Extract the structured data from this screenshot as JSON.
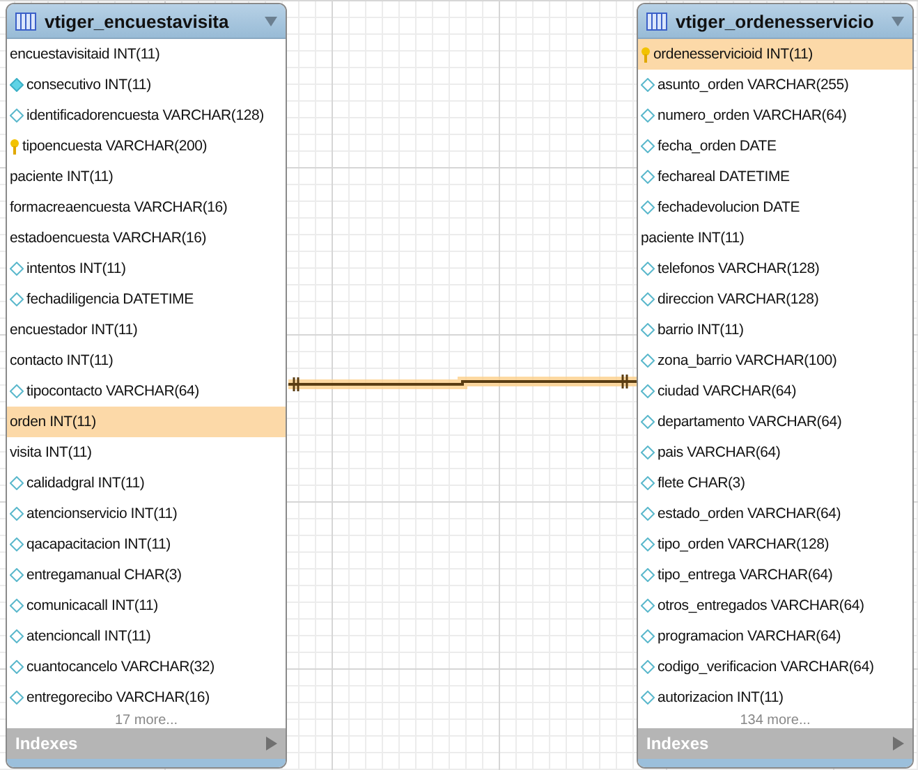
{
  "tables": [
    {
      "title": "vtiger_encuestavisita",
      "more": "17 more...",
      "section": "Indexes",
      "columns": [
        {
          "text": "encuestavisitaid INT(11)",
          "kind": "plain",
          "selected": false
        },
        {
          "text": "consecutivo INT(11)",
          "kind": "unique",
          "selected": false
        },
        {
          "text": "identificadorencuesta VARCHAR(128)",
          "kind": "nullable",
          "selected": false
        },
        {
          "text": "tipoencuesta VARCHAR(200)",
          "kind": "key",
          "selected": false
        },
        {
          "text": "paciente INT(11)",
          "kind": "plain",
          "selected": false
        },
        {
          "text": "formacreaencuesta VARCHAR(16)",
          "kind": "plain",
          "selected": false
        },
        {
          "text": "estadoencuesta VARCHAR(16)",
          "kind": "plain",
          "selected": false
        },
        {
          "text": "intentos INT(11)",
          "kind": "nullable",
          "selected": false
        },
        {
          "text": "fechadiligencia DATETIME",
          "kind": "nullable",
          "selected": false
        },
        {
          "text": "encuestador INT(11)",
          "kind": "plain",
          "selected": false
        },
        {
          "text": "contacto INT(11)",
          "kind": "plain",
          "selected": false
        },
        {
          "text": "tipocontacto VARCHAR(64)",
          "kind": "nullable",
          "selected": false
        },
        {
          "text": "orden INT(11)",
          "kind": "plain",
          "selected": true
        },
        {
          "text": "visita INT(11)",
          "kind": "plain",
          "selected": false
        },
        {
          "text": "calidadgral INT(11)",
          "kind": "nullable",
          "selected": false
        },
        {
          "text": "atencionservicio INT(11)",
          "kind": "nullable",
          "selected": false
        },
        {
          "text": "qacapacitacion INT(11)",
          "kind": "nullable",
          "selected": false
        },
        {
          "text": "entregamanual CHAR(3)",
          "kind": "nullable",
          "selected": false
        },
        {
          "text": "comunicacall INT(11)",
          "kind": "nullable",
          "selected": false
        },
        {
          "text": "atencioncall INT(11)",
          "kind": "nullable",
          "selected": false
        },
        {
          "text": "cuantocancelo VARCHAR(32)",
          "kind": "nullable",
          "selected": false
        },
        {
          "text": "entregorecibo VARCHAR(16)",
          "kind": "nullable",
          "selected": false
        }
      ]
    },
    {
      "title": "vtiger_ordenesservicio",
      "more": "134 more...",
      "section": "Indexes",
      "columns": [
        {
          "text": "ordenesservicioid INT(11)",
          "kind": "key",
          "selected": true
        },
        {
          "text": "asunto_orden VARCHAR(255)",
          "kind": "nullable",
          "selected": false
        },
        {
          "text": "numero_orden VARCHAR(64)",
          "kind": "nullable",
          "selected": false
        },
        {
          "text": "fecha_orden DATE",
          "kind": "nullable",
          "selected": false
        },
        {
          "text": "fechareal DATETIME",
          "kind": "nullable",
          "selected": false
        },
        {
          "text": "fechadevolucion DATE",
          "kind": "nullable",
          "selected": false
        },
        {
          "text": "paciente INT(11)",
          "kind": "plain",
          "selected": false
        },
        {
          "text": "telefonos VARCHAR(128)",
          "kind": "nullable",
          "selected": false
        },
        {
          "text": "direccion VARCHAR(128)",
          "kind": "nullable",
          "selected": false
        },
        {
          "text": "barrio INT(11)",
          "kind": "nullable",
          "selected": false
        },
        {
          "text": "zona_barrio VARCHAR(100)",
          "kind": "nullable",
          "selected": false
        },
        {
          "text": "ciudad VARCHAR(64)",
          "kind": "nullable",
          "selected": false
        },
        {
          "text": "departamento VARCHAR(64)",
          "kind": "nullable",
          "selected": false
        },
        {
          "text": "pais VARCHAR(64)",
          "kind": "nullable",
          "selected": false
        },
        {
          "text": "flete CHAR(3)",
          "kind": "nullable",
          "selected": false
        },
        {
          "text": "estado_orden VARCHAR(64)",
          "kind": "nullable",
          "selected": false
        },
        {
          "text": "tipo_orden VARCHAR(128)",
          "kind": "nullable",
          "selected": false
        },
        {
          "text": "tipo_entrega VARCHAR(64)",
          "kind": "nullable",
          "selected": false
        },
        {
          "text": "otros_entregados VARCHAR(64)",
          "kind": "nullable",
          "selected": false
        },
        {
          "text": "programacion VARCHAR(64)",
          "kind": "nullable",
          "selected": false
        },
        {
          "text": "codigo_verificacion VARCHAR(64)",
          "kind": "nullable",
          "selected": false
        },
        {
          "text": "autorizacion INT(11)",
          "kind": "nullable",
          "selected": false
        }
      ]
    }
  ]
}
